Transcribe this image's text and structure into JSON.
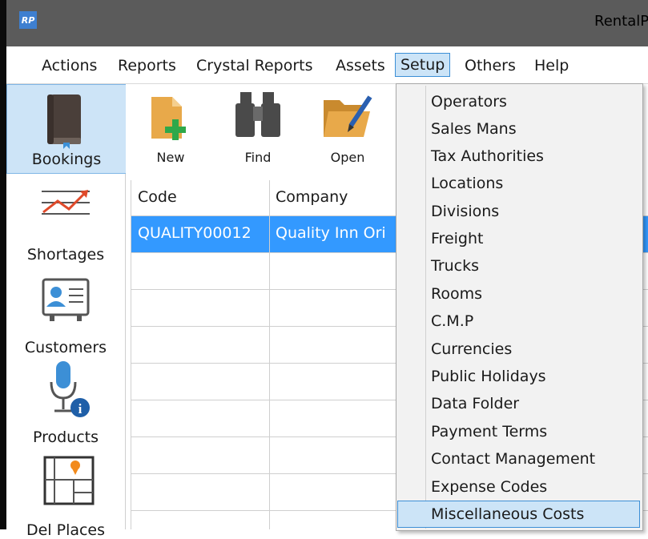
{
  "window": {
    "app_icon_text": "RP",
    "title": "RentalP"
  },
  "menubar": {
    "items": [
      "Actions",
      "Reports",
      "Crystal Reports",
      "Assets",
      "Setup",
      "Others",
      "Help"
    ],
    "active": "Setup"
  },
  "sidenav": {
    "items": [
      {
        "label": "Bookings",
        "icon": "book-icon",
        "selected": true
      },
      {
        "label": "Shortages",
        "icon": "chart-line-icon"
      },
      {
        "label": "Customers",
        "icon": "contact-card-icon"
      },
      {
        "label": "Products",
        "icon": "microphone-info-icon"
      },
      {
        "label": "Del Places",
        "icon": "map-pin-icon"
      }
    ]
  },
  "toolbar": {
    "buttons": [
      {
        "label": "New",
        "icon": "new-document-icon"
      },
      {
        "label": "Find",
        "icon": "binoculars-icon"
      },
      {
        "label": "Open",
        "icon": "open-folder-icon"
      }
    ]
  },
  "grid": {
    "columns": [
      "Code",
      "Company"
    ],
    "rows": [
      {
        "code": "QUALITY00012",
        "company": "Quality Inn Ori",
        "selected": true
      }
    ]
  },
  "setup_menu": {
    "items": [
      "Operators",
      "Sales Mans",
      "Tax Authorities",
      "Locations",
      "Divisions",
      "Freight",
      "Trucks",
      "Rooms",
      "C.M.P",
      "Currencies",
      "Public Holidays",
      "Data Folder",
      "Payment Terms",
      "Contact Management",
      "Expense Codes",
      "Miscellaneous Costs"
    ],
    "hovered": "Miscellaneous Costs"
  },
  "colors": {
    "selection": "#3399ff",
    "menu_highlight": "#cce4f7",
    "menu_border": "#3c8fd6",
    "titlebar": "#5b5b5b"
  }
}
